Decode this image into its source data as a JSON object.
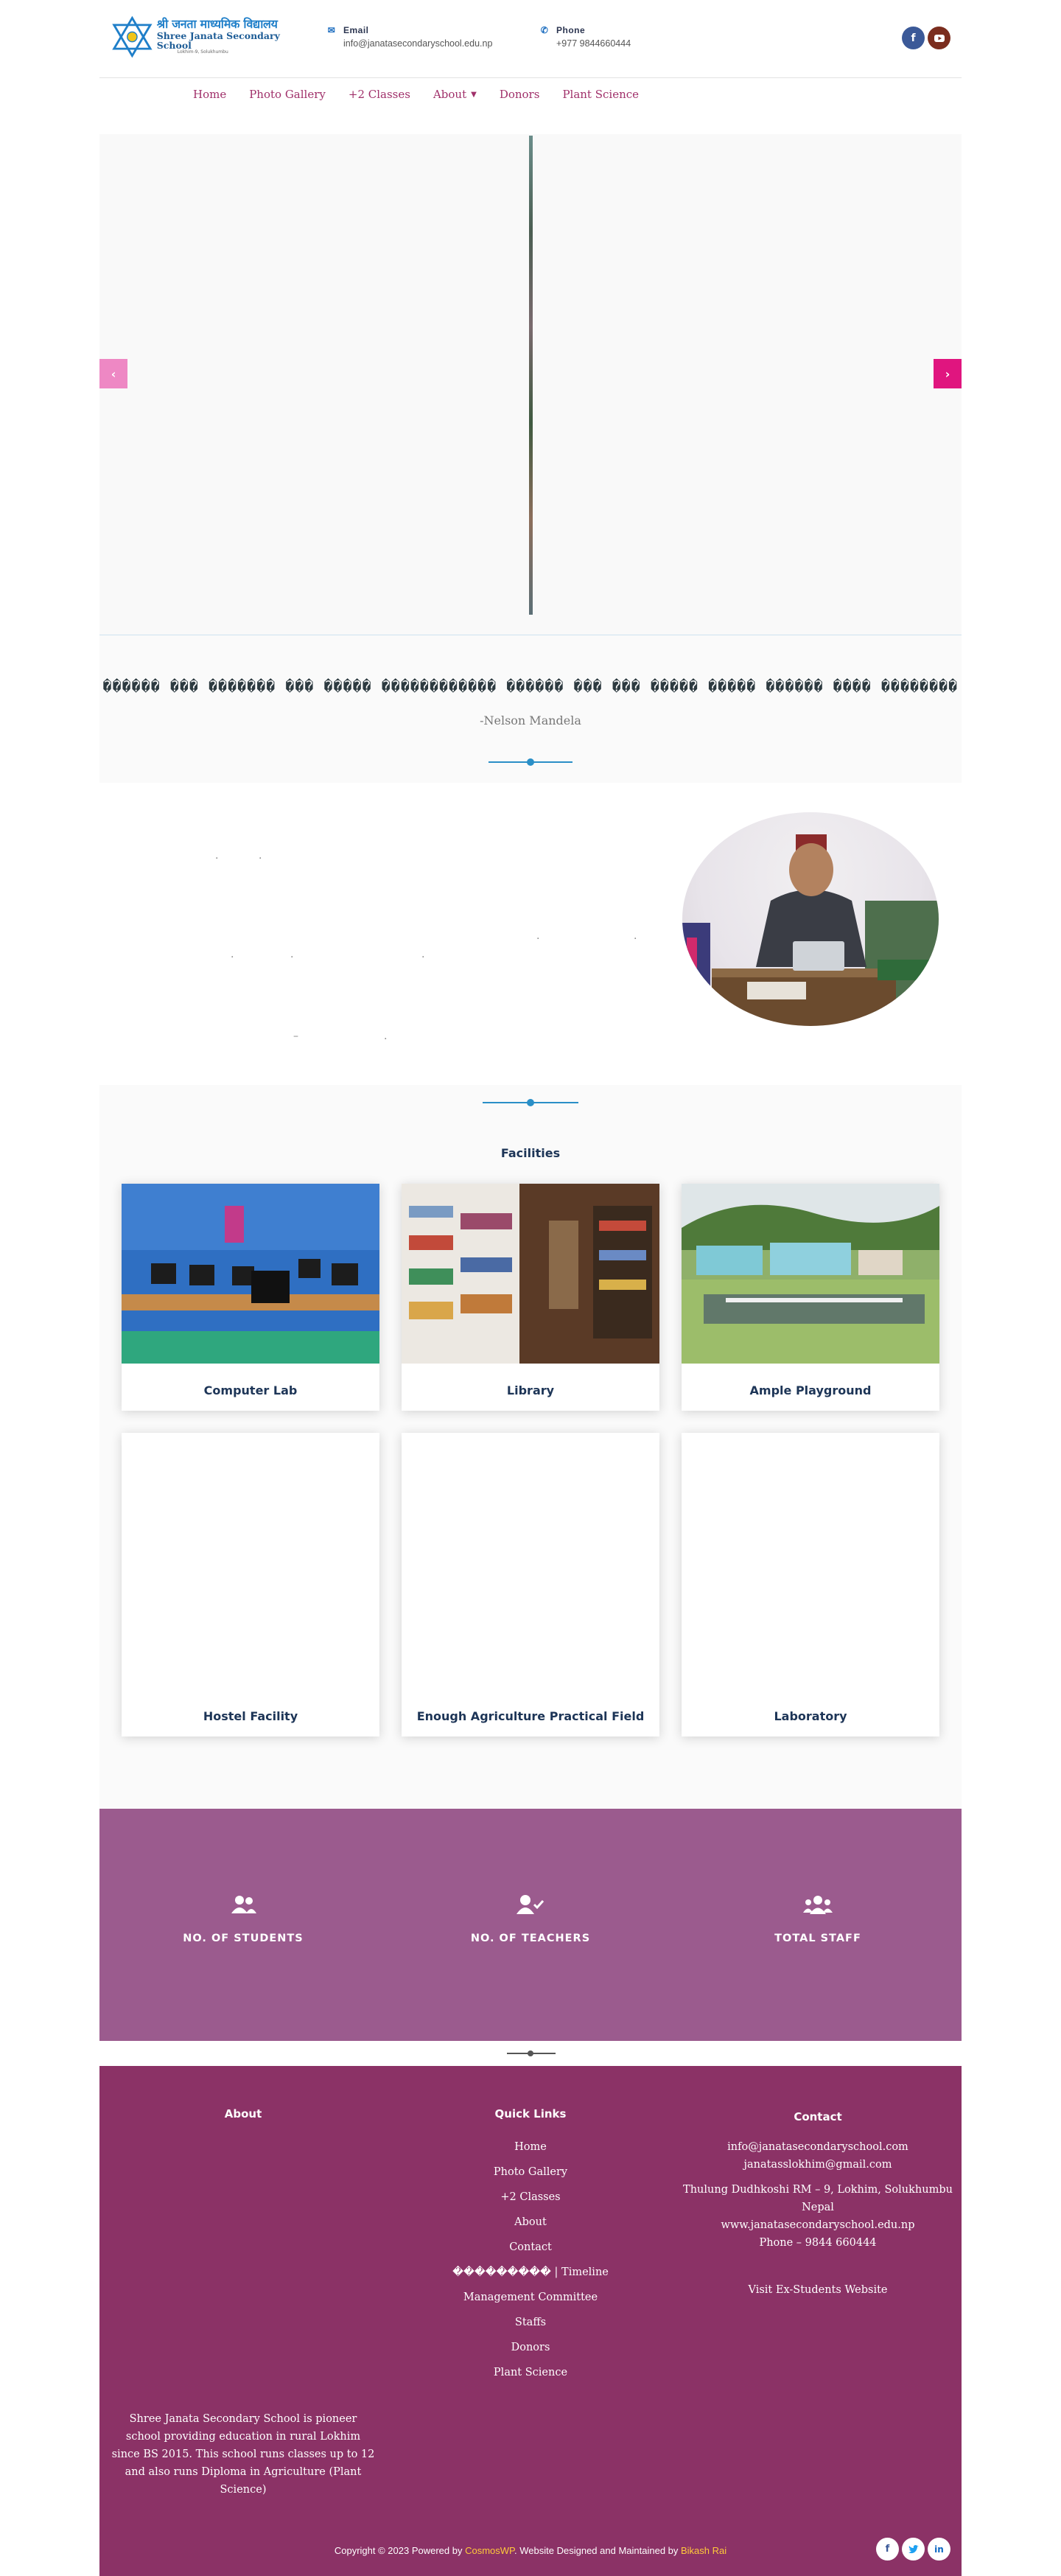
{
  "header": {
    "logo_nepali": "श्री जनता माध्यमिक विद्यालय",
    "logo_english": "Shree Janata Secondary School",
    "logo_sub": "Lokhim-9, Solukhumbu",
    "email_label": "Email",
    "email_value": "info@janatasecondaryschool.edu.np",
    "phone_label": "Phone",
    "phone_value": "+977 9844660444",
    "social_icons": [
      "facebook-icon",
      "youtube-icon"
    ]
  },
  "nav": {
    "items": [
      "Home",
      "Photo Gallery",
      "+2 Classes",
      "About",
      "Donors",
      "Plant Science"
    ]
  },
  "slider": {
    "prev_icon": "chevron-left-icon",
    "next_icon": "chevron-right-icon"
  },
  "quote": {
    "text": "������ ��� ������� ��� ����� ������������ ������ ��� ��� ����� ����� ������ ���� ��������",
    "author": "-Nelson Mandela"
  },
  "facilities": {
    "title": "Facilities",
    "cards": [
      "Computer Lab",
      "Library",
      "Ample Playground",
      "Hostel Facility",
      "Enough Agriculture Practical Field",
      "Laboratory"
    ]
  },
  "stats": {
    "items": [
      {
        "icon": "users-icon",
        "label": "NO. OF STUDENTS"
      },
      {
        "icon": "user-check-icon",
        "label": "NO. OF TEACHERS"
      },
      {
        "icon": "user-group-icon",
        "label": "TOTAL STAFF"
      }
    ]
  },
  "footer": {
    "about_title": "About",
    "about_text": "Shree Janata Secondary School is pioneer school providing education in rural Lokhim since BS 2015. This school runs classes up to 12 and also runs Diploma in Agriculture (Plant Science)",
    "quick_links_title": "Quick Links",
    "quick_links": [
      "Home",
      "Photo Gallery",
      "+2 Classes",
      "About",
      "Contact",
      "��������� | Timeline",
      "Management Committee",
      "Staffs",
      "Donors",
      "Plant Science"
    ],
    "contact_title": "Contact",
    "contact_email1": "info@janatasecondaryschool.com",
    "contact_email2": "janatasslokhim@gmail.com",
    "contact_address": "Thulung Dudhkoshi  RM – 9, Lokhim, Solukhumbu",
    "contact_country": "Nepal",
    "contact_web": "www.janatasecondaryschool.edu.np",
    "contact_phone": "Phone – 9844 660444",
    "ex_students_link": "Visit Ex-Students Website",
    "copyright_prefix": "Copyright © 2023 Powered by ",
    "copyright_brand": "CosmosWP",
    "copyright_middle": ". Website Designed and Maintained by ",
    "copyright_author": "Bikash Rai",
    "social_icons": [
      "facebook-icon",
      "twitter-icon",
      "linkedin-icon"
    ]
  },
  "colors": {
    "accent_pink": "#e0157f",
    "stats_bg": "#9b5b8e",
    "footer_bg": "#8b3266",
    "nav_text": "#a0306a",
    "heading": "#1d3557"
  }
}
